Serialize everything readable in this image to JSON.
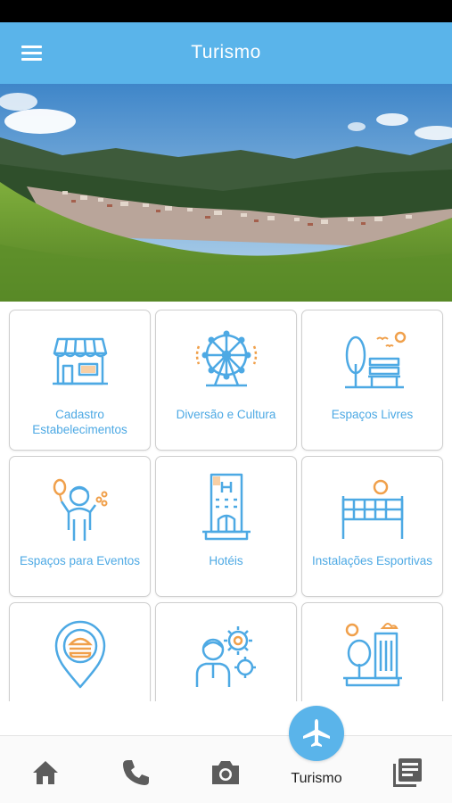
{
  "app_bar": {
    "title": "Turismo"
  },
  "colors": {
    "primary": "#5ab4ea",
    "tile_label": "#4da9e4",
    "icon_orange": "#f0a04b",
    "nav_icon": "#5c5c5c"
  },
  "tiles": [
    {
      "label": "Cadastro Estabelecimentos",
      "icon": "storefront-icon"
    },
    {
      "label": "Diversão e Cultura",
      "icon": "ferris-wheel-icon"
    },
    {
      "label": "Espaços Livres",
      "icon": "park-bench-icon"
    },
    {
      "label": "Espaços para Eventos",
      "icon": "party-person-balloons-icon"
    },
    {
      "label": "Hotéis",
      "icon": "hotel-building-icon"
    },
    {
      "label": "Instalações Esportivas",
      "icon": "volleyball-net-icon"
    },
    {
      "label": "",
      "icon": "food-location-pin-icon"
    },
    {
      "label": "",
      "icon": "person-gears-icon"
    },
    {
      "label": "",
      "icon": "city-buildings-icon"
    }
  ],
  "bottom_nav": {
    "items": [
      {
        "icon": "home-icon"
      },
      {
        "icon": "phone-icon"
      },
      {
        "icon": "camera-icon"
      },
      {
        "icon": "airplane-icon",
        "label": "Turismo",
        "active": true
      },
      {
        "icon": "news-list-icon"
      }
    ]
  }
}
